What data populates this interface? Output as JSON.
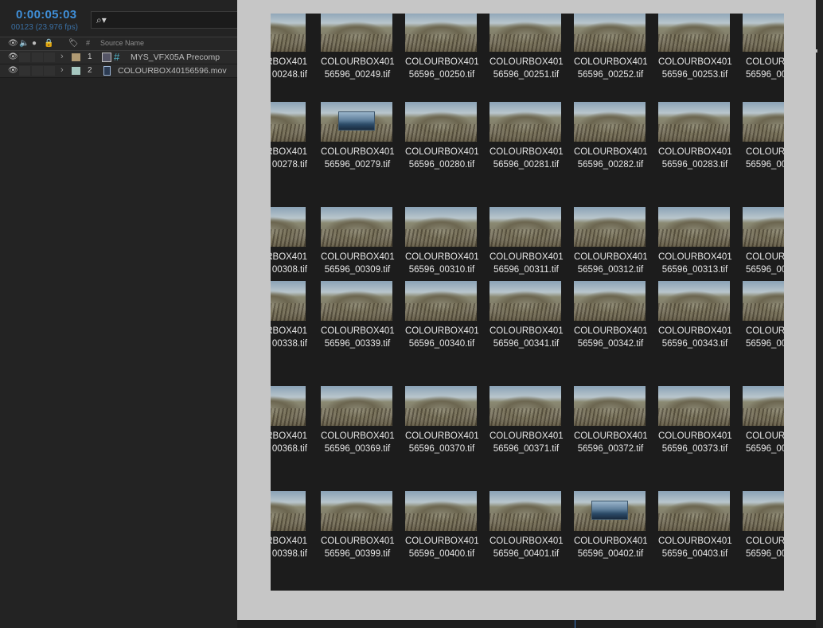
{
  "timeline": {
    "timecode": "0:00:05:03",
    "frame_info": "00123 (23.976 fps)",
    "search_placeholder": "⌕▾",
    "header": {
      "num_label": "#",
      "source_name_label": "Source Name"
    },
    "layers": [
      {
        "num": "1",
        "name": "MYS_VFX05A Precomp",
        "label_color": "#b09a73",
        "type": "precomp"
      },
      {
        "num": "2",
        "name": "COLOURBOX40156596.mov",
        "label_color": "#a6c7c0",
        "type": "footage"
      }
    ]
  },
  "thumbnail_rows": [
    {
      "line1": "COLOURBOX401",
      "files": [
        "00248.tif",
        "56596_00249.tif",
        "56596_00250.tif",
        "56596_00251.tif",
        "56596_00252.tif",
        "56596_00253.tif",
        "56596_00"
      ],
      "line1_first": "RBOX401",
      "line1_last": "COLOUR"
    },
    {
      "line1": "COLOURBOX401",
      "files": [
        "00278.tif",
        "56596_00279.tif",
        "56596_00280.tif",
        "56596_00281.tif",
        "56596_00282.tif",
        "56596_00283.tif",
        "56596_00"
      ],
      "line1_first": "RBOX401",
      "line1_last": "COLOUR"
    },
    {
      "line1": "COLOURBOX401",
      "files": [
        "00308.tif",
        "56596_00309.tif",
        "56596_00310.tif",
        "56596_00311.tif",
        "56596_00312.tif",
        "56596_00313.tif",
        "56596_00"
      ],
      "line1_first": "RBOX401",
      "line1_last": "COLOUR"
    },
    {
      "line1": "COLOURBOX401",
      "files": [
        "00338.tif",
        "56596_00339.tif",
        "56596_00340.tif",
        "56596_00341.tif",
        "56596_00342.tif",
        "56596_00343.tif",
        "56596_00"
      ],
      "line1_first": "RBOX401",
      "line1_last": "COLOUR"
    },
    {
      "line1": "COLOURBOX401",
      "files": [
        "00368.tif",
        "56596_00369.tif",
        "56596_00370.tif",
        "56596_00371.tif",
        "56596_00372.tif",
        "56596_00373.tif",
        "56596_00"
      ],
      "line1_first": "RBOX401",
      "line1_last": "COLOUR"
    },
    {
      "line1": "COLOURBOX401",
      "files": [
        "00398.tif",
        "56596_00399.tif",
        "56596_00400.tif",
        "56596_00401.tif",
        "56596_00402.tif",
        "56596_00403.tif",
        "56596_00"
      ],
      "line1_first": "RBOX401",
      "line1_last": "COLOUR"
    }
  ],
  "highlighted_frames": [
    "56596_00279.tif",
    "56596_00402.tif"
  ],
  "colors": {
    "accent_timecode": "#3f8fd9",
    "panel_bg": "#232323",
    "window_frame": "#c6c6c6",
    "grid_bg": "#1c1c1c"
  }
}
